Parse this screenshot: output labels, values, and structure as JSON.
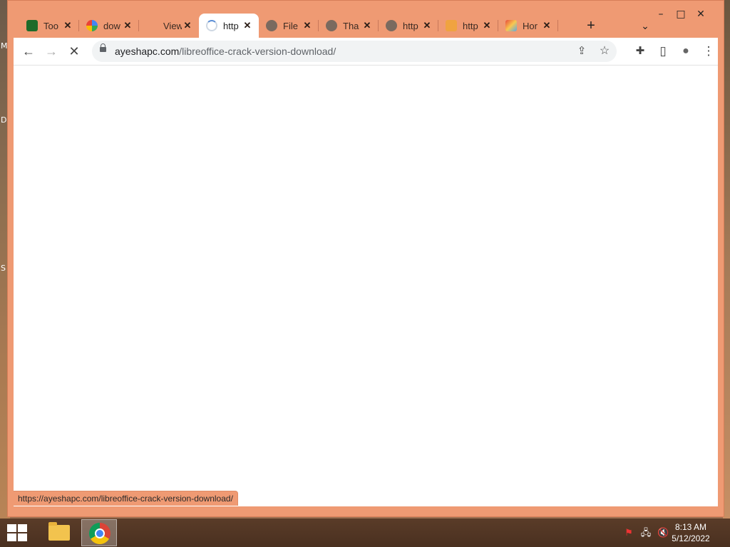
{
  "desktop": {
    "left_letters": [
      "M",
      "D",
      "S"
    ]
  },
  "window": {
    "minimize_icon": "–",
    "maximize_icon": "□",
    "close_icon": "✕"
  },
  "tabs": [
    {
      "label": "Too",
      "icon": "gear-green",
      "close": "✕"
    },
    {
      "label": "dow",
      "icon": "google-g",
      "close": "✕"
    },
    {
      "label": "View",
      "icon": "blank",
      "close": "✕"
    },
    {
      "label": "http",
      "icon": "loading-spinner",
      "close": "✕",
      "active": true
    },
    {
      "label": "File",
      "icon": "globe",
      "close": "✕"
    },
    {
      "label": "Tha",
      "icon": "globe",
      "close": "✕"
    },
    {
      "label": "http",
      "icon": "globe",
      "close": "✕"
    },
    {
      "label": "http",
      "icon": "orange-star",
      "close": "✕"
    },
    {
      "label": "Hor",
      "icon": "colorful-logo",
      "close": "✕"
    }
  ],
  "tab_actions": {
    "new_tab": "+",
    "tab_search": "⌄"
  },
  "toolbar": {
    "back": "←",
    "forward": "→",
    "stop": "✕",
    "url_host": "ayeshapc.com",
    "url_path": "/libreoffice-crack-version-download/",
    "share_icon": "⇪",
    "bookmark_icon": "☆",
    "extensions_icon": "✚",
    "sidepanel_icon": "▯",
    "profile_icon": "●",
    "menu_icon": "⋮"
  },
  "status_bar": {
    "text": "https://ayeshapc.com/libreoffice-crack-version-download/"
  },
  "taskbar": {
    "apps": [
      "file-explorer",
      "google-chrome"
    ],
    "tray": {
      "flag": "⚑",
      "network": "🖧",
      "volume": "🔇"
    },
    "clock": {
      "time": "8:13 AM",
      "date": "5/12/2022"
    }
  }
}
